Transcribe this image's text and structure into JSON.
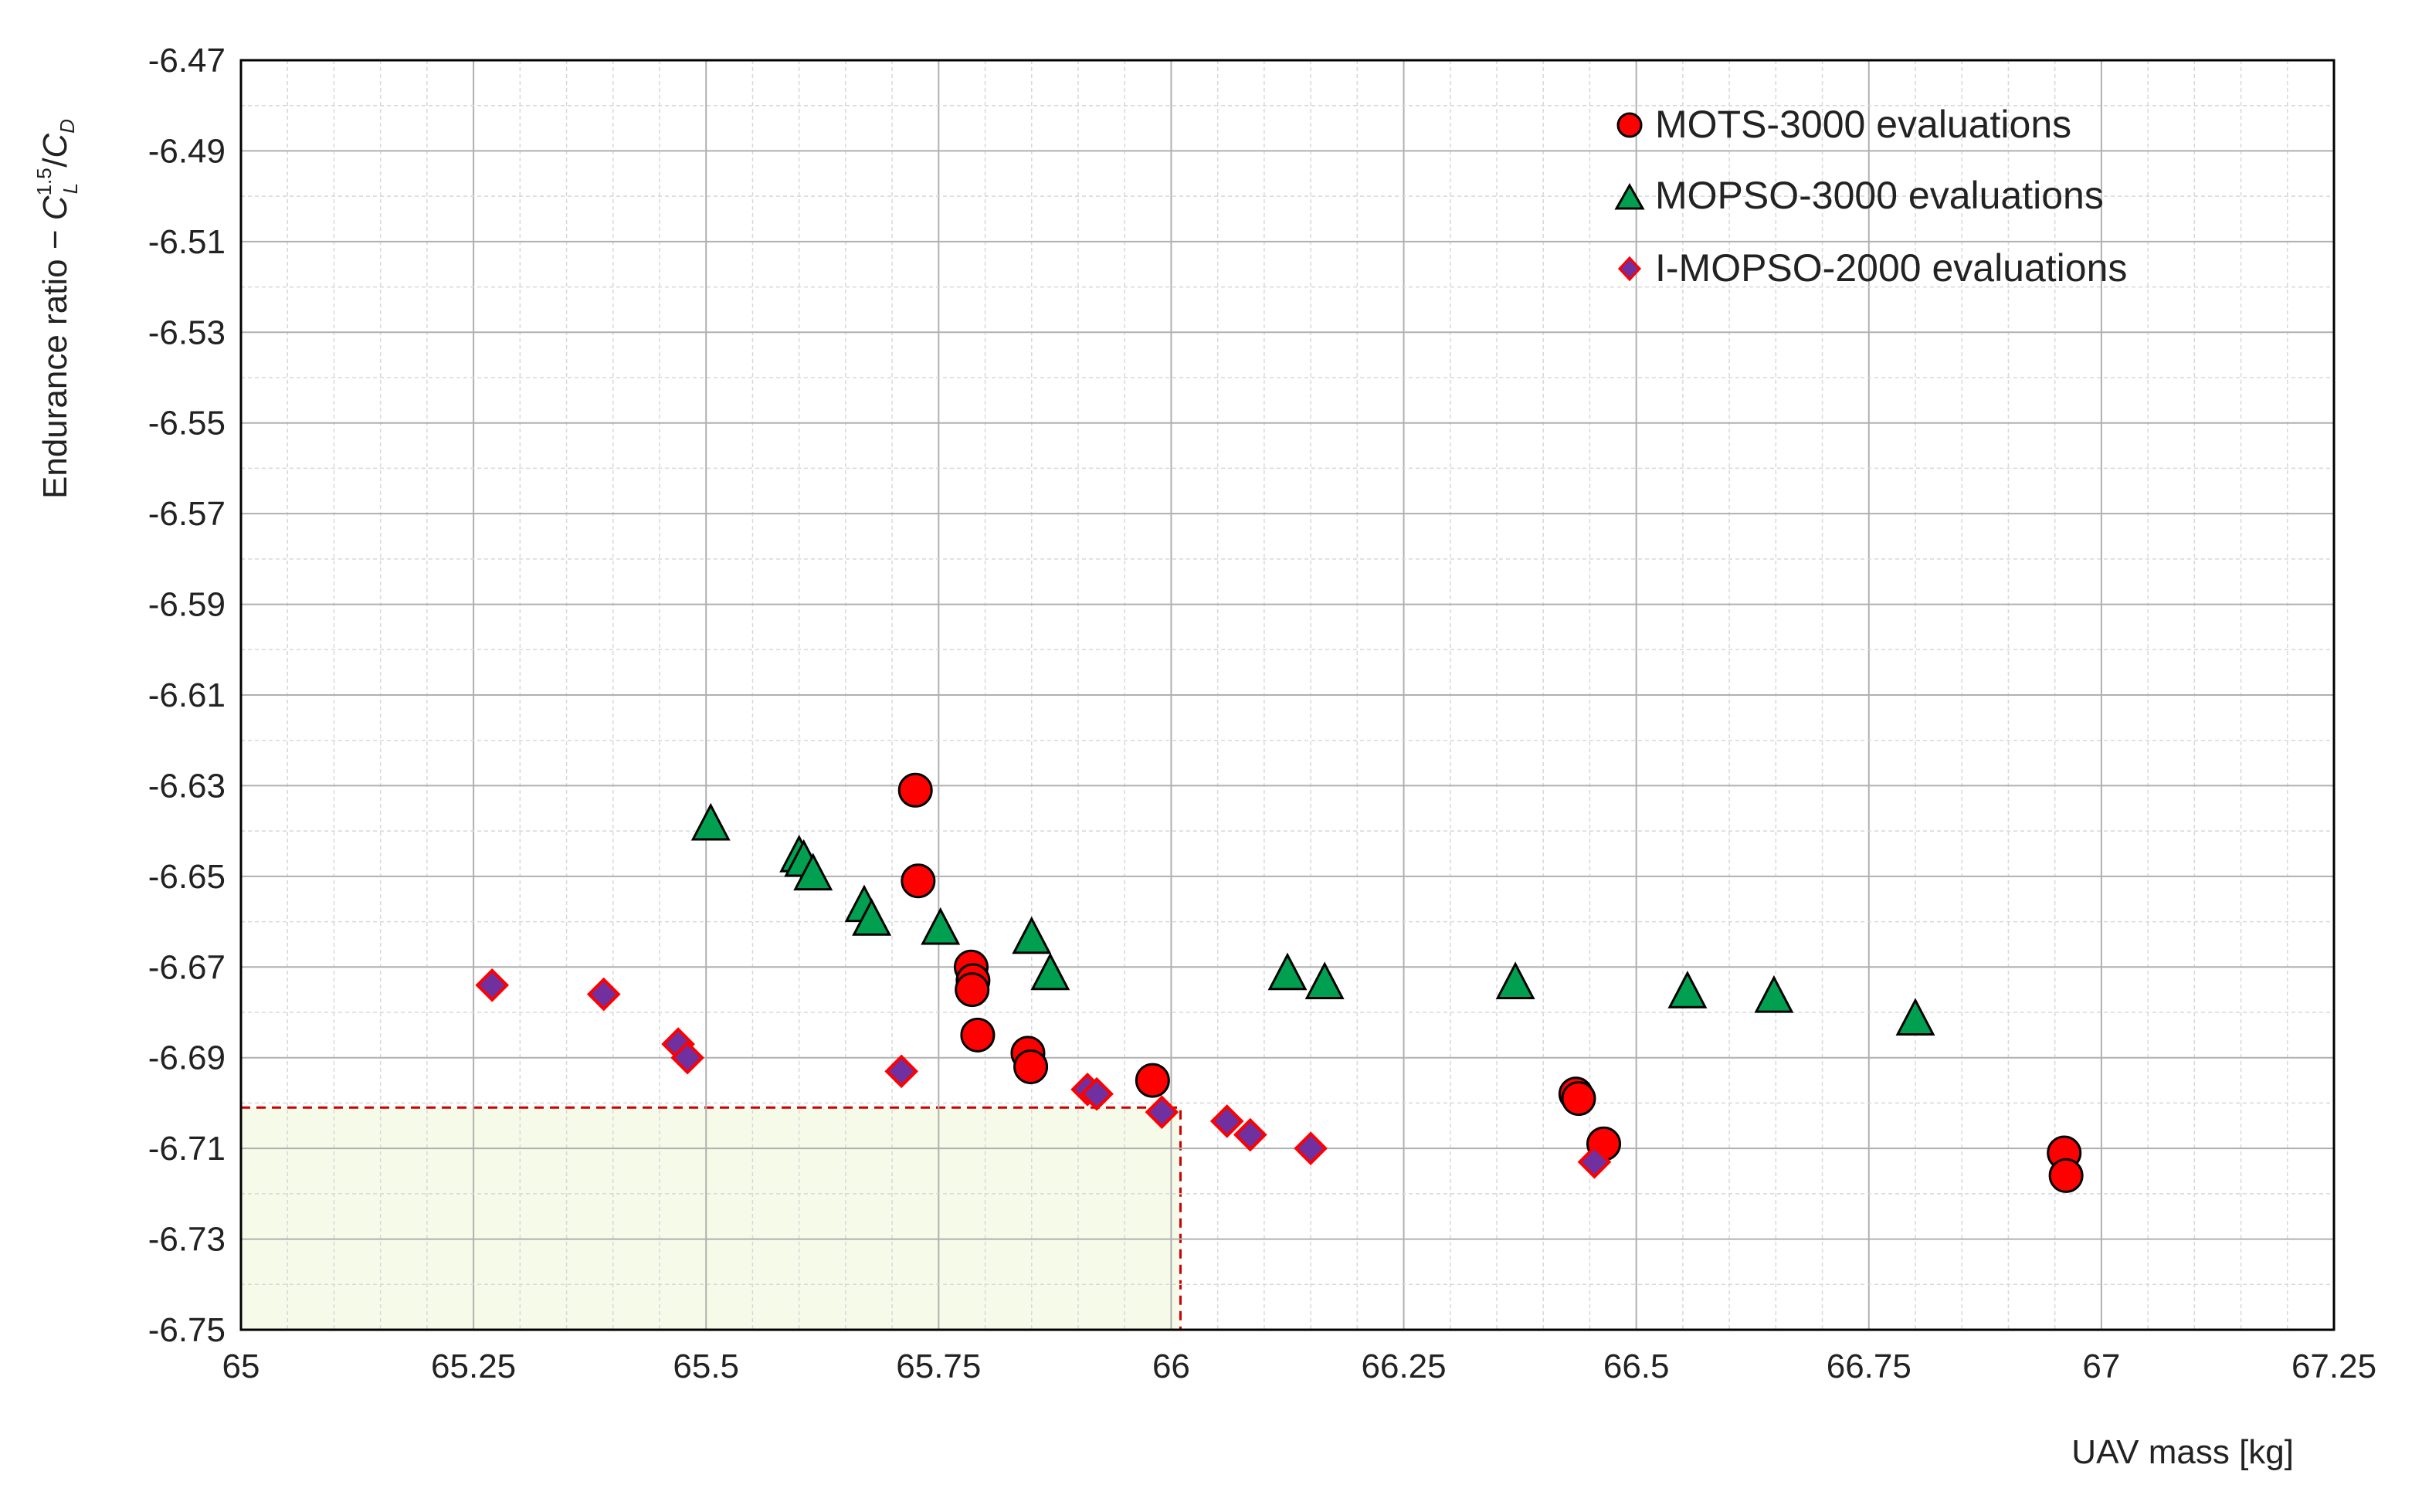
{
  "chart_data": {
    "type": "scatter",
    "title": "",
    "xlabel": "UAV mass [kg]",
    "ylabel": "Endurance ratio − ",
    "ylabel_formula": {
      "c1": "C",
      "c1_sub": "L",
      "c1_sup": "1.5",
      "slash": "/",
      "c2": "C",
      "c2_sub": "D"
    },
    "xlim": [
      65,
      67.25
    ],
    "ylim": [
      -6.75,
      -6.47
    ],
    "grid": true,
    "legend_position": "top-right",
    "x_ticks": [
      "65",
      "65.25",
      "65.5",
      "65.75",
      "66",
      "66.25",
      "66.5",
      "66.75",
      "67",
      "67.25"
    ],
    "y_ticks": [
      "-6.47",
      "-6.49",
      "-6.51",
      "-6.53",
      "-6.55",
      "-6.57",
      "-6.59",
      "-6.61",
      "-6.63",
      "-6.65",
      "-6.67",
      "-6.69",
      "-6.71",
      "-6.73",
      "-6.75"
    ],
    "highlight_region": {
      "x": [
        65,
        66.01
      ],
      "y": [
        -6.75,
        -6.701
      ],
      "fill": "#f6fae8",
      "stroke": "#cc0000"
    },
    "series": [
      {
        "name": "MOTS-3000 evaluations",
        "marker": "circle",
        "color": "#ff0000",
        "points": [
          [
            65.725,
            -6.631
          ],
          [
            65.728,
            -6.651
          ],
          [
            65.785,
            -6.67
          ],
          [
            65.787,
            -6.673
          ],
          [
            65.786,
            -6.675
          ],
          [
            65.792,
            -6.685
          ],
          [
            65.846,
            -6.689
          ],
          [
            65.849,
            -6.692
          ],
          [
            65.98,
            -6.695
          ],
          [
            66.435,
            -6.698
          ],
          [
            66.438,
            -6.699
          ],
          [
            66.465,
            -6.709
          ],
          [
            66.96,
            -6.711
          ],
          [
            66.962,
            -6.716
          ]
        ]
      },
      {
        "name": "MOPSO-3000 evaluations",
        "marker": "triangle",
        "color": "#00a050",
        "points": [
          [
            65.505,
            -6.639
          ],
          [
            65.6,
            -6.646
          ],
          [
            65.605,
            -6.647
          ],
          [
            65.615,
            -6.65
          ],
          [
            65.67,
            -6.657
          ],
          [
            65.678,
            -6.66
          ],
          [
            65.752,
            -6.662
          ],
          [
            65.85,
            -6.664
          ],
          [
            65.87,
            -6.672
          ],
          [
            66.125,
            -6.672
          ],
          [
            66.165,
            -6.674
          ],
          [
            66.37,
            -6.674
          ],
          [
            66.555,
            -6.676
          ],
          [
            66.648,
            -6.677
          ],
          [
            66.8,
            -6.682
          ]
        ]
      },
      {
        "name": "I-MOPSO-2000 evaluations",
        "marker": "diamond",
        "color": "#7030a0",
        "stroke": "#ff0000",
        "points": [
          [
            65.27,
            -6.674
          ],
          [
            65.39,
            -6.676
          ],
          [
            65.47,
            -6.687
          ],
          [
            65.48,
            -6.69
          ],
          [
            65.71,
            -6.693
          ],
          [
            65.91,
            -6.697
          ],
          [
            65.92,
            -6.698
          ],
          [
            65.99,
            -6.702
          ],
          [
            66.06,
            -6.704
          ],
          [
            66.085,
            -6.707
          ],
          [
            66.15,
            -6.71
          ],
          [
            66.455,
            -6.713
          ]
        ]
      }
    ]
  }
}
